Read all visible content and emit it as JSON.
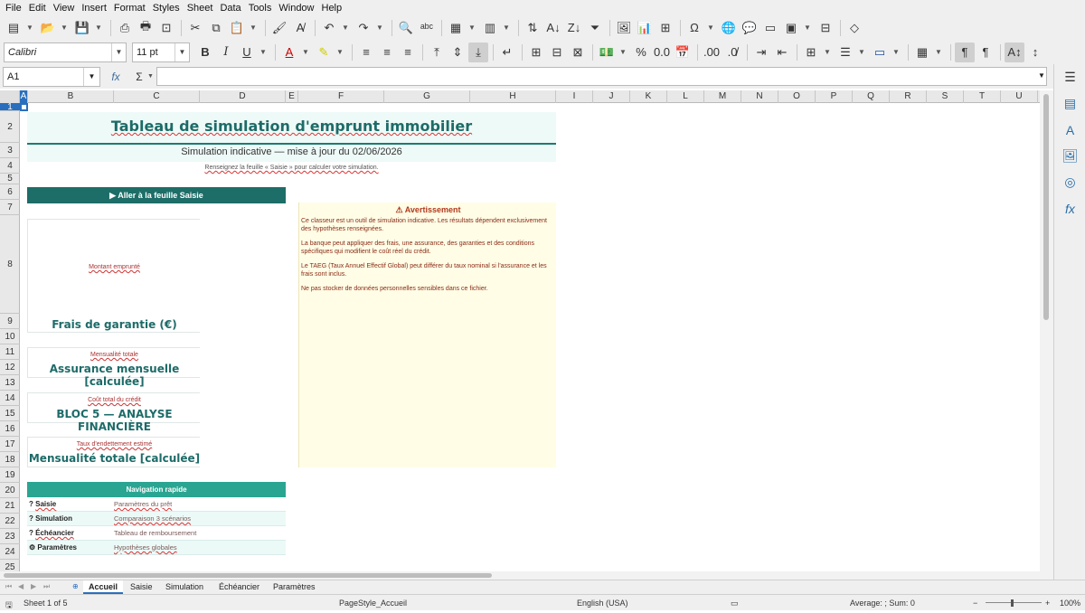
{
  "menu": [
    "File",
    "Edit",
    "View",
    "Insert",
    "Format",
    "Styles",
    "Sheet",
    "Data",
    "Tools",
    "Window",
    "Help"
  ],
  "toolbar2": {
    "font_name": "Calibri",
    "font_size": "11 pt"
  },
  "formula_bar": {
    "cell_ref": "A1",
    "formula": "",
    "fx": "fx",
    "sum": "Σ",
    "eq": "="
  },
  "columns": [
    "A",
    "B",
    "C",
    "D",
    "E",
    "F",
    "G",
    "H",
    "I",
    "J",
    "K",
    "L",
    "M",
    "N",
    "O",
    "P",
    "Q",
    "R",
    "S",
    "T",
    "U"
  ],
  "rows": [
    "1",
    "2",
    "3",
    "4",
    "5",
    "6",
    "7",
    "8",
    "9",
    "10",
    "11",
    "12",
    "13",
    "14",
    "15",
    "16",
    "17",
    "18",
    "19",
    "20",
    "21",
    "22",
    "23",
    "24",
    "25"
  ],
  "sheet": {
    "title": "Tableau de simulation d'emprunt immobilier",
    "subtitle": "Simulation indicative — mise à jour du 02/06/2026",
    "hint": "Renseignez la feuille « Saisie » pour calculer votre simulation.",
    "goto_button": "▶ Aller à la feuille Saisie",
    "kpis": [
      {
        "label": "Montant emprunté",
        "value": "Frais de garantie (€)"
      },
      {
        "label": "Mensualité totale",
        "value": "Assurance mensuelle [calculée]"
      },
      {
        "label": "Coût total du crédit",
        "value": "BLOC 5 — ANALYSE FINANCIÈRE"
      },
      {
        "label": "Taux d'endettement estimé",
        "value": "Mensualité totale [calculée]"
      }
    ],
    "warning": {
      "title": "⚠ Avertissement",
      "paragraphs": [
        "Ce classeur est un outil de simulation indicative. Les résultats dépendent exclusivement des hypothèses renseignées.",
        "La banque peut appliquer des frais, une assurance, des garanties et des conditions spécifiques qui modifient le coût réel du crédit.",
        "Le TAEG (Taux Annuel Effectif Global) peut différer du taux nominal si l'assurance et les frais sont inclus.",
        "Ne pas stocker de données personnelles sensibles dans ce fichier."
      ]
    },
    "quick_nav": {
      "title": "Navigation rapide",
      "items": [
        {
          "icon": "?",
          "name": "Saisie",
          "desc": "Paramètres du prêt"
        },
        {
          "icon": "?",
          "name": "Simulation",
          "desc": "Comparaison 3 scénarios"
        },
        {
          "icon": "?",
          "name": "Échéancier",
          "desc": "Tableau de remboursement"
        },
        {
          "icon": "⚙",
          "name": "Paramètres",
          "desc": "Hypothèses globales"
        }
      ]
    }
  },
  "tabs": [
    "Accueil",
    "Saisie",
    "Simulation",
    "Échéancier",
    "Paramètres"
  ],
  "status": {
    "sheet_info": "Sheet 1 of 5",
    "page_style": "PageStyle_Accueil",
    "language": "English (USA)",
    "summary": "Average: ; Sum: 0",
    "zoom": "100%"
  }
}
